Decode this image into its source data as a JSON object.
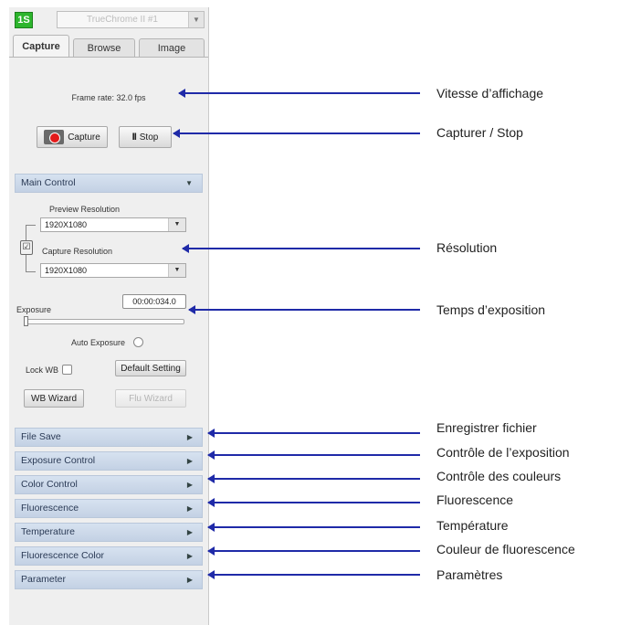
{
  "app": {
    "logo_text": "1S",
    "camera_select": "TrueChrome II #1"
  },
  "tabs": [
    {
      "label": "Capture",
      "active": true
    },
    {
      "label": "Browse",
      "active": false
    },
    {
      "label": "Image",
      "active": false
    }
  ],
  "capture_pane": {
    "frame_rate": "Frame rate: 32.0 fps",
    "capture_button": "Capture",
    "stop_button": "Stop",
    "main_control": {
      "header": "Main Control",
      "preview_resolution_label": "Preview Resolution",
      "preview_resolution_value": "1920X1080",
      "capture_resolution_label": "Capture Resolution",
      "capture_resolution_value": "1920X1080",
      "exposure_label": "Exposure",
      "exposure_value": "00:00:034.0",
      "exposure_slider_level": 0.0,
      "auto_exposure_label": "Auto Exposure",
      "auto_exposure_checked": false,
      "lock_wb_label": "Lock WB",
      "lock_wb_checked": false,
      "default_setting_button": "Default Setting",
      "wb_wizard_button": "WB Wizard",
      "flu_wizard_button": "Flu Wizard"
    },
    "collapsed_sections": [
      "File Save",
      "Exposure Control",
      "Color Control",
      "Fluorescence",
      "Temperature",
      "Fluorescence Color",
      "Parameter"
    ]
  },
  "annotations": [
    "Vitesse d’affichage",
    "Capturer / Stop",
    "Résolution",
    "Temps d’exposition",
    "Enregistrer fichier",
    "Contrôle de l’exposition",
    "Contrôle des couleurs",
    "Fluorescence",
    "Température",
    "Couleur de fluorescence",
    "Paramètres"
  ],
  "colors": {
    "arrow": "#1f2aa8",
    "section_header": "#c9d6e8",
    "logo": "#2db52d",
    "record_dot": "#e31919"
  }
}
